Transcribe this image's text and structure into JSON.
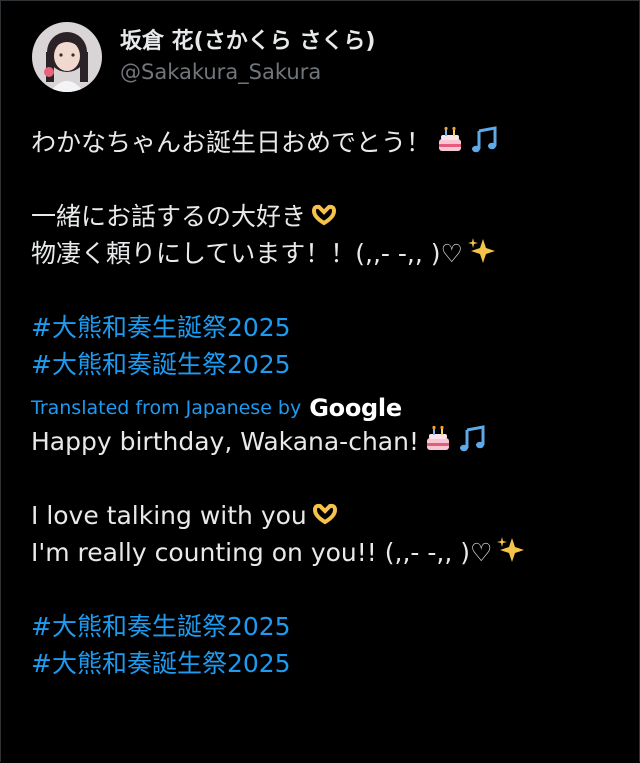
{
  "author": {
    "display_name": "坂倉 花(さかくら さくら)",
    "handle": "@Sakakura_Sakura",
    "avatar": "avatar"
  },
  "post": {
    "line1": "わかなちゃんお誕生日おめでとう！",
    "line2": "一緒にお話するの大好き",
    "line3": "物凄く頼りにしています！！(,,- -,, )♡",
    "hashtag1": "#大熊和奏生誕祭2025",
    "hashtag2": "#大熊和奏誕生祭2025"
  },
  "translation": {
    "label": "Translated from Japanese by",
    "provider": "Google",
    "line1": "Happy birthday, Wakana-chan!",
    "line2": "I love talking with you",
    "line3": "I'm really counting on you!! (,,- -,, )♡",
    "hashtag1": "#大熊和奏生誕祭2025",
    "hashtag2": "#大熊和奏誕生祭2025"
  },
  "icons": {
    "cake": "birthday-cake-icon",
    "notes": "musical-notes-icon",
    "heart_hands": "heart-hands-icon",
    "sparkles": "sparkles-icon"
  },
  "colors": {
    "background": "#000000",
    "text": "#e7e9ea",
    "muted": "#71767b",
    "link": "#1d9bf0"
  }
}
